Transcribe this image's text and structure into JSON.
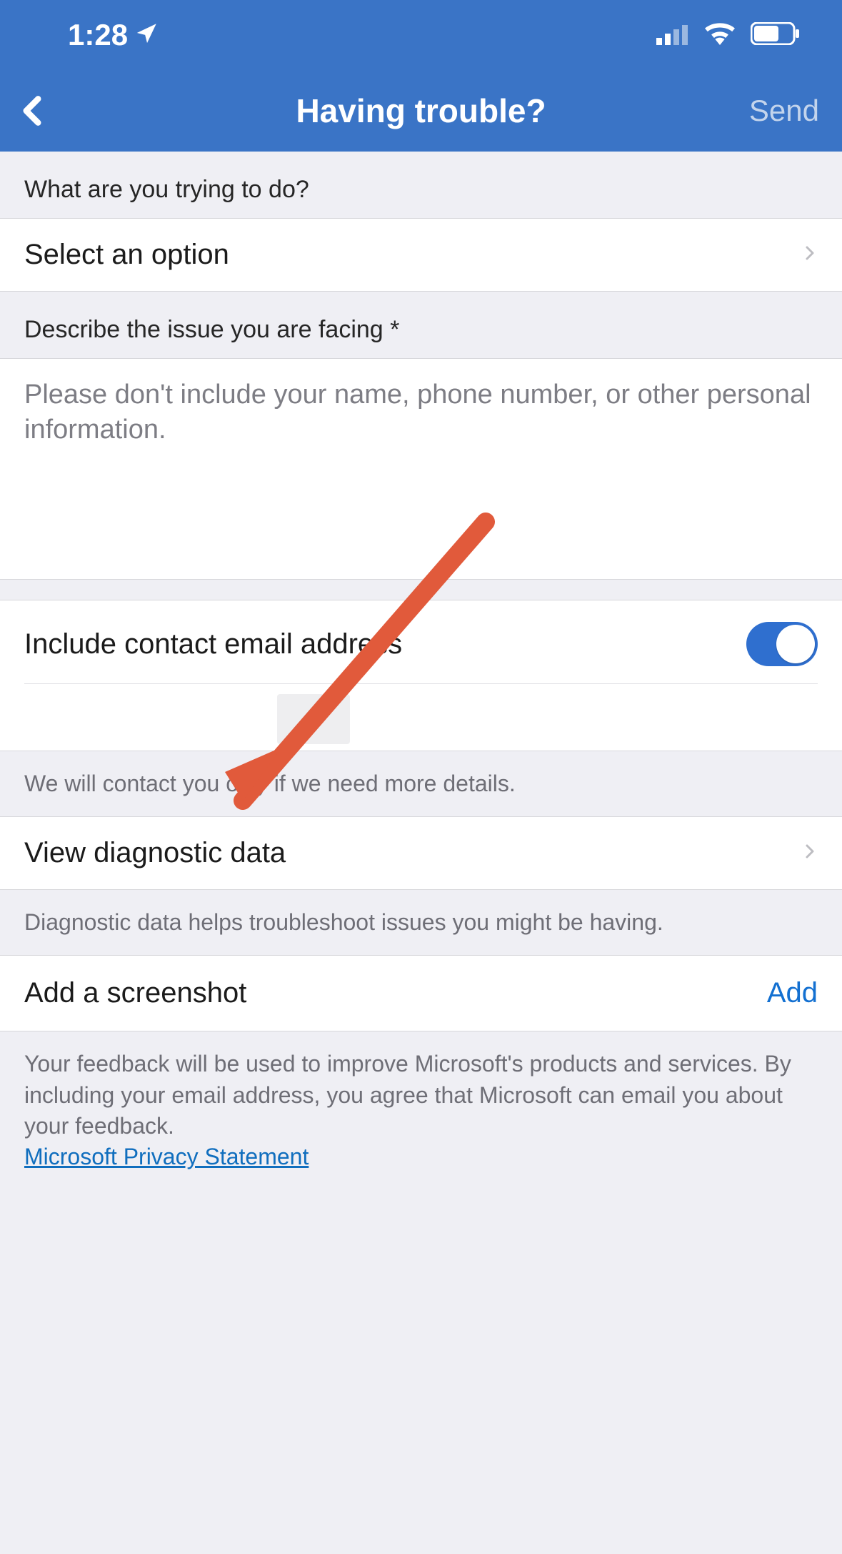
{
  "statusbar": {
    "time": "1:28"
  },
  "nav": {
    "title": "Having trouble?",
    "send": "Send"
  },
  "section1": {
    "header": "What are you trying to do?",
    "select_placeholder": "Select an option"
  },
  "section2": {
    "header": "Describe the issue you are facing *",
    "placeholder": "Please don't include your name, phone number, or other personal information."
  },
  "email": {
    "toggle_label": "Include contact email address",
    "note": "We will contact you only if we need more details."
  },
  "diagnostic": {
    "label": "View diagnostic data",
    "note": "Diagnostic data helps troubleshoot issues you might be having."
  },
  "screenshot": {
    "label": "Add a screenshot",
    "action": "Add"
  },
  "footer": {
    "text": "Your feedback will be used to improve Microsoft's products and services. By including your email address, you agree that Microsoft can email you about your feedback.",
    "link": "Microsoft Privacy Statement"
  }
}
